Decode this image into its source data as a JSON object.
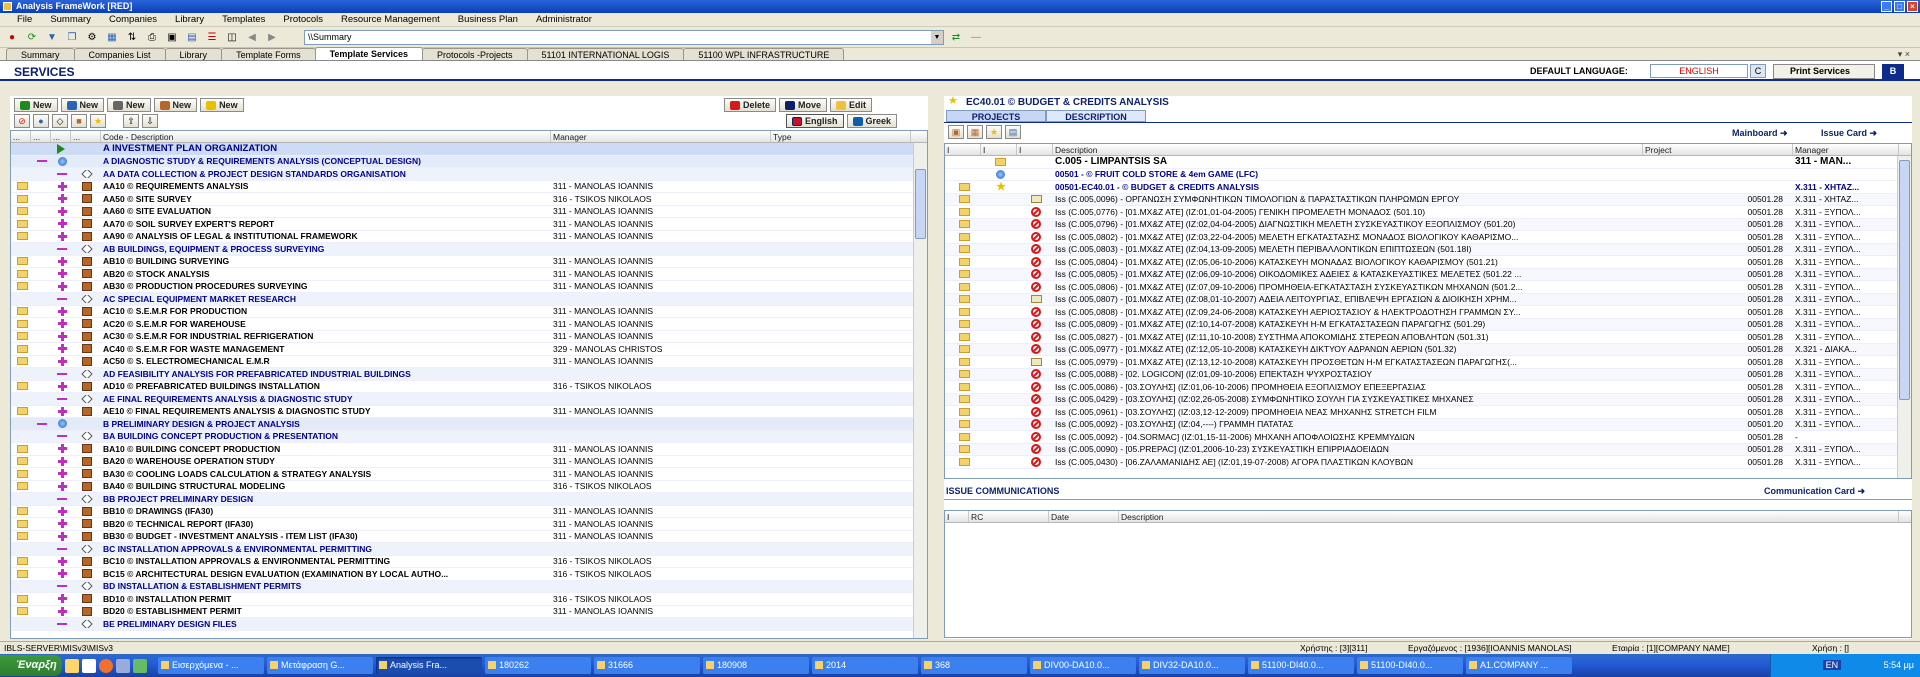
{
  "window": {
    "title": "Analysis FrameWork   [RED]"
  },
  "menu": [
    "File",
    "Summary",
    "Companies",
    "Library",
    "Templates",
    "Protocols",
    "Resource Management",
    "Business Plan",
    "Administrator"
  ],
  "toolbar": {
    "address": "\\\\Summary"
  },
  "tabs": [
    {
      "label": "Summary"
    },
    {
      "label": "Companies List"
    },
    {
      "label": "Library"
    },
    {
      "label": "Template Forms"
    },
    {
      "label": "Template Services",
      "active": true
    },
    {
      "label": "Protocols -Projects"
    },
    {
      "label": "51101 INTERNATIONAL LOGIS"
    },
    {
      "label": "51100 WPL INFRASTRUCTURE"
    }
  ],
  "header": {
    "title": "SERVICES",
    "default_language_label": "DEFAULT LANGUAGE:",
    "default_language_value": "ENGLISH",
    "c_button": "C",
    "print_button": "Print Services",
    "b_button": "B"
  },
  "left": {
    "new_buttons": [
      "New",
      "New",
      "New",
      "New",
      "New"
    ],
    "delete_label": "Delete",
    "move_label": "Move",
    "edit_label": "Edit",
    "english_label": "English",
    "greek_label": "Greek",
    "columns": [
      "...",
      "...",
      "...",
      "...",
      "Code - Description",
      "Manager",
      "Type"
    ],
    "rows": [
      {
        "k": "h1",
        "icons": [
          "",
          "",
          "tri",
          ""
        ],
        "text": "A INVESTMENT PLAN ORGANIZATION",
        "mgr": ""
      },
      {
        "k": "h2",
        "icons": [
          "",
          "dash",
          "globe",
          ""
        ],
        "text": "A DIAGNOSTIC STUDY & REQUIREMENTS ANALYSIS (CONCEPTUAL DESIGN)",
        "mgr": ""
      },
      {
        "k": "h3",
        "icons": [
          "",
          "",
          "dash",
          "diam"
        ],
        "text": "AA DATA COLLECTION & PROJECT DESIGN STANDARDS ORGANISATION",
        "mgr": ""
      },
      {
        "k": "it",
        "icons": [
          "fold",
          "",
          "plus",
          "book"
        ],
        "text": "AA10 © REQUIREMENTS ANALYSIS",
        "mgr": "311 - MANOLAS IOANNIS"
      },
      {
        "k": "it",
        "icons": [
          "fold",
          "",
          "plus",
          "book"
        ],
        "text": "AA50 © SITE SURVEY",
        "mgr": "316 - TSIKOS NIKOLAOS"
      },
      {
        "k": "it",
        "icons": [
          "fold",
          "",
          "plus",
          "book"
        ],
        "text": "AA60 © SITE EVALUATION",
        "mgr": "311 - MANOLAS IOANNIS"
      },
      {
        "k": "it",
        "icons": [
          "fold",
          "",
          "plus",
          "book"
        ],
        "text": "AA70 © SOIL SURVEY EXPERT'S REPORT",
        "mgr": "311 - MANOLAS IOANNIS"
      },
      {
        "k": "it",
        "icons": [
          "fold",
          "",
          "plus",
          "book"
        ],
        "text": "AA90 © ANALYSIS OF LEGAL & INSTITUTIONAL FRAMEWORK",
        "mgr": "311 - MANOLAS IOANNIS"
      },
      {
        "k": "h3",
        "icons": [
          "",
          "",
          "dash",
          "diam"
        ],
        "text": "AB BUILDINGS, EQUIPMENT & PROCESS SURVEYING",
        "mgr": ""
      },
      {
        "k": "it",
        "icons": [
          "fold",
          "",
          "plus",
          "book"
        ],
        "text": "AB10 © BUILDING SURVEYING",
        "mgr": "311 - MANOLAS IOANNIS"
      },
      {
        "k": "it",
        "icons": [
          "fold",
          "",
          "plus",
          "book"
        ],
        "text": "AB20 © STOCK ANALYSIS",
        "mgr": "311 - MANOLAS IOANNIS"
      },
      {
        "k": "it",
        "icons": [
          "fold",
          "",
          "plus",
          "book"
        ],
        "text": "AB30 © PRODUCTION PROCEDURES SURVEYING",
        "mgr": "311 - MANOLAS IOANNIS"
      },
      {
        "k": "h3",
        "icons": [
          "",
          "",
          "dash",
          "diam"
        ],
        "text": "AC SPECIAL EQUIPMENT MARKET RESEARCH",
        "mgr": ""
      },
      {
        "k": "it",
        "icons": [
          "fold",
          "",
          "plus",
          "book"
        ],
        "text": "AC10 © S.E.M.R FOR PRODUCTION",
        "mgr": "311 - MANOLAS IOANNIS"
      },
      {
        "k": "it",
        "icons": [
          "fold",
          "",
          "plus",
          "book"
        ],
        "text": "AC20 © S.E.M.R FOR WAREHOUSE",
        "mgr": "311 - MANOLAS IOANNIS"
      },
      {
        "k": "it",
        "icons": [
          "fold",
          "",
          "plus",
          "book"
        ],
        "text": "AC30 © S.E.M.R FOR INDUSTRIAL REFRIGERATION",
        "mgr": "311 - MANOLAS IOANNIS"
      },
      {
        "k": "it",
        "icons": [
          "fold",
          "",
          "plus",
          "book"
        ],
        "text": "AC40 © S.E.M.R FOR WASTE MANAGEMENT",
        "mgr": "329 - MANOLAS CHRISTOS"
      },
      {
        "k": "it",
        "icons": [
          "fold",
          "",
          "plus",
          "book"
        ],
        "text": "AC50 © S. ELECTROMECHANICAL E.M.R",
        "mgr": "311 - MANOLAS IOANNIS"
      },
      {
        "k": "h3",
        "icons": [
          "",
          "",
          "dash",
          "diam"
        ],
        "text": "AD FEASIBILITY ANALYSIS FOR PREFABRICATED INDUSTRIAL BUILDINGS",
        "mgr": ""
      },
      {
        "k": "it",
        "icons": [
          "fold",
          "",
          "plus",
          "book"
        ],
        "text": "AD10 ©  PREFABRICATED BUILDINGS INSTALLATION",
        "mgr": "316 - TSIKOS NIKOLAOS"
      },
      {
        "k": "h3",
        "icons": [
          "",
          "",
          "dash",
          "diam"
        ],
        "text": "AE FINAL REQUIREMENTS  ANALYSIS & DIAGNOSTIC STUDY",
        "mgr": ""
      },
      {
        "k": "it",
        "icons": [
          "fold",
          "",
          "plus",
          "book"
        ],
        "text": "AE10 © FINAL REQUIREMENTS  ANALYSIS & DIAGNOSTIC STUDY",
        "mgr": "311 - MANOLAS IOANNIS"
      },
      {
        "k": "h2",
        "icons": [
          "",
          "dash",
          "globe",
          ""
        ],
        "text": "B PRELIMINARY DESIGN & PROJECT ANALYSIS",
        "mgr": ""
      },
      {
        "k": "h3",
        "icons": [
          "",
          "",
          "dash",
          "diam"
        ],
        "text": "BA BUILDING CONCEPT PRODUCTION & PRESENTATION",
        "mgr": ""
      },
      {
        "k": "it",
        "icons": [
          "fold",
          "",
          "plus",
          "book"
        ],
        "text": "BA10 © BUILDING CONCEPT PRODUCTION",
        "mgr": "311 - MANOLAS IOANNIS"
      },
      {
        "k": "it",
        "icons": [
          "fold",
          "",
          "plus",
          "book"
        ],
        "text": "BA20 © WAREHOUSE OPERATION STUDY",
        "mgr": "311 - MANOLAS IOANNIS"
      },
      {
        "k": "it",
        "icons": [
          "fold",
          "",
          "plus",
          "book"
        ],
        "text": "BA30 © COOLING LOADS CALCULATION & STRATEGY ANALYSIS",
        "mgr": "311 - MANOLAS IOANNIS"
      },
      {
        "k": "it",
        "icons": [
          "fold",
          "",
          "plus",
          "book"
        ],
        "text": "BA40 © BUILDING STRUCTURAL MODELING",
        "mgr": "316 - TSIKOS NIKOLAOS"
      },
      {
        "k": "h3",
        "icons": [
          "",
          "",
          "dash",
          "diam"
        ],
        "text": "BB PROJECT PRELIMINARY DESIGN",
        "mgr": ""
      },
      {
        "k": "it",
        "icons": [
          "fold",
          "",
          "plus",
          "book"
        ],
        "text": "BB10 © DRAWINGS (IFA30)",
        "mgr": "311 - MANOLAS IOANNIS"
      },
      {
        "k": "it",
        "icons": [
          "fold",
          "",
          "plus",
          "book"
        ],
        "text": "BB20 © TECHNICAL REPORT (IFA30)",
        "mgr": "311 - MANOLAS IOANNIS"
      },
      {
        "k": "it",
        "icons": [
          "fold",
          "",
          "plus",
          "book"
        ],
        "text": "BB30 © BUDGET - INVESTMENT ANALYSIS - ITEM LIST (IFA30)",
        "mgr": "311 - MANOLAS IOANNIS"
      },
      {
        "k": "h3",
        "icons": [
          "",
          "",
          "dash",
          "diam"
        ],
        "text": "BC INSTALLATION APPROVALS & ENVIRONMENTAL PERMITTING",
        "mgr": ""
      },
      {
        "k": "it",
        "icons": [
          "fold",
          "",
          "plus",
          "book"
        ],
        "text": "BC10 © INSTALLATION APPROVALS & ENVIRONMENTAL PERMITTING",
        "mgr": "316 - TSIKOS NIKOLAOS"
      },
      {
        "k": "it",
        "icons": [
          "fold",
          "",
          "plus",
          "book"
        ],
        "text": "BC15  © ARCHITECTURAL DESIGN EVALUATION (EXAMINATION BY LOCAL AUTHO...",
        "mgr": "316 - TSIKOS NIKOLAOS"
      },
      {
        "k": "h3",
        "icons": [
          "",
          "",
          "dash",
          "diam"
        ],
        "text": "BD INSTALLATION & ESTABLISHMENT PERMITS",
        "mgr": ""
      },
      {
        "k": "it",
        "icons": [
          "fold",
          "",
          "plus",
          "book"
        ],
        "text": "BD10 © INSTALLATION PERMIT",
        "mgr": "316 - TSIKOS NIKOLAOS"
      },
      {
        "k": "it",
        "icons": [
          "fold",
          "",
          "plus",
          "book"
        ],
        "text": "BD20 © ESTABLISHMENT PERMIT",
        "mgr": "311 - MANOLAS IOANNIS"
      },
      {
        "k": "h3",
        "icons": [
          "",
          "",
          "dash",
          "diam"
        ],
        "text": "BE PRELIMINARY DESIGN FILES",
        "mgr": ""
      }
    ]
  },
  "right": {
    "title": "EC40.01  ©  BUDGET & CREDITS ANALYSIS",
    "tabs": [
      "PROJECTS",
      "DESCRIPTION"
    ],
    "mainboard_link": "Mainboard",
    "issue_card_link": "Issue Card",
    "columns": [
      "I",
      "I",
      "I",
      "Description",
      "Project",
      "Manager"
    ],
    "rows": [
      {
        "k": "top",
        "i": [
          "",
          "fold",
          ""
        ],
        "d": "C.005 - LIMPANTSIS SA",
        "p": "",
        "m": "311 - MAN..."
      },
      {
        "k": "sub",
        "i": [
          "",
          "globe",
          ""
        ],
        "d": "00501 - © FRUIT COLD STORE & 4em GAME (LFC)",
        "p": "",
        "m": ""
      },
      {
        "k": "sub2",
        "i": [
          "fold",
          "star",
          ""
        ],
        "d": "00501-EC40.01 - © BUDGET & CREDITS ANALYSIS",
        "p": "",
        "m": "X.311 - XHTAZ..."
      },
      {
        "k": "r",
        "i": [
          "fold",
          "",
          "env"
        ],
        "d": "Iss (C.005,0096) - ΟΡΓΑΝΩΣΗ ΣΥΜΦΩΝΗΤΙΚΩΝ ΤΙΜΟΛΟΓΙΩΝ & ΠΑΡΑΣΤΑΣΤΙΚΩΝ ΠΛΗΡΩΜΩΝ ΕΡΓΟΥ",
        "p": "00501.28",
        "m": "X.311 - XHTAZ..."
      },
      {
        "k": "r",
        "i": [
          "fold",
          "",
          "noent"
        ],
        "d": "Iss (C.005,0776) - [01.MX&Z ATE] (IZ:01,01-04-2005) ΓΕΝΙΚΗ ΠΡΟΜΕΛΕΤΗ ΜΟΝΑΔΟΣ (501.10)",
        "p": "00501.28",
        "m": "X.311 - ΞΥΠΟΛ..."
      },
      {
        "k": "r",
        "i": [
          "fold",
          "",
          "noent"
        ],
        "d": "Iss (C.005,0796) - [01.MX&Z ATE] (IZ:02,04-04-2005) ΔΙΑΓΝΩΣΤΙΚΗ ΜΕΛΕΤΗ ΣΥΣΚΕΥΑΣΤΙΚΟΥ ΕΞΟΠΛΙΣΜΟΥ (501.20)",
        "p": "00501.28",
        "m": "X.311 - ΞΥΠΟΛ..."
      },
      {
        "k": "r",
        "i": [
          "fold",
          "",
          "noent"
        ],
        "d": "Iss (C.005,0802) - [01.MX&Z ATE] (IZ:03,22-04-2005) ΜΕΛΕΤΗ ΕΓΚΑΤΑΣΤΑΣΗΣ ΜΟΝΑΔΟΣ ΒΙΟΛΟΓΙΚΟΥ ΚΑΘΑΡΙΣΜΟ...",
        "p": "00501.28",
        "m": "X.311 - ΞΥΠΟΛ..."
      },
      {
        "k": "r",
        "i": [
          "fold",
          "",
          "noent"
        ],
        "d": "Iss (C.005,0803) - [01.MX&Z ATE] (IZ:04,13-09-2005) ΜΕΛΕΤΗ ΠΕΡΙΒΑΛΛΟΝΤΙΚΩΝ ΕΠΙΠΤΩΣΕΩΝ (501.18I)",
        "p": "00501.28",
        "m": "X.311 - ΞΥΠΟΛ..."
      },
      {
        "k": "r",
        "i": [
          "fold",
          "",
          "noent"
        ],
        "d": "Iss (C.005,0804) - [01.MX&Z ATE] (IZ:05,06-10-2006) ΚΑΤΑΣΚΕΥΗ ΜΟΝΑΔΑΣ ΒΙΟΛΟΓΙΚΟΥ ΚΑΘΑΡΙΣΜΟΥ (501.21)",
        "p": "00501.28",
        "m": "X.311 - ΞΥΠΟΛ..."
      },
      {
        "k": "r",
        "i": [
          "fold",
          "",
          "noent"
        ],
        "d": "Iss (C.005,0805) - [01.MX&Z ATE] (IZ:06,09-10-2006) ΟΙΚΟΔΟΜΙΚΕΣ ΑΔΕΙΕΣ & ΚΑΤΑΣΚΕΥΑΣΤΙΚΕΣ ΜΕΛΕΤΕΣ (501.22 ...",
        "p": "00501.28",
        "m": "X.311 - ΞΥΠΟΛ..."
      },
      {
        "k": "r",
        "i": [
          "fold",
          "",
          "noent"
        ],
        "d": "Iss (C.005,0806) - [01.MX&Z ATE] (IZ:07,09-10-2006) ΠΡΟΜΗΘΕΙΑ-ΕΓΚΑΤΑΣΤΑΣΗ ΣΥΣΚΕΥΑΣΤΙΚΩΝ ΜΗΧΑΝΩΝ (501.2...",
        "p": "00501.28",
        "m": "X.311 - ΞΥΠΟΛ..."
      },
      {
        "k": "r",
        "i": [
          "fold",
          "",
          "env"
        ],
        "d": "Iss (C.005,0807) - [01.MX&Z ATE] (IZ:08,01-10-2007) ΑΔΕΙΑ ΛΕΙΤΟΥΡΓΙΑΣ, ΕΠΙΒΛΕΨΗ ΕΡΓΑΣΙΩΝ & ΔΙΟΙΚΗΣΗ ΧΡΗΜ...",
        "p": "00501.28",
        "m": "X.311 - ΞΥΠΟΛ..."
      },
      {
        "k": "r",
        "i": [
          "fold",
          "",
          "noent"
        ],
        "d": "Iss (C.005,0808) - [01.MX&Z ATE] (IZ:09,24-06-2008) ΚΑΤΑΣΚΕΥΗ ΑΕΡΙΟΣΤΑΣΙΟΥ & ΗΛΕΚΤΡΟΔΟΤΗΣΗ ΓΡΑΜΜΩΝ ΣΥ...",
        "p": "00501.28",
        "m": "X.311 - ΞΥΠΟΛ..."
      },
      {
        "k": "r",
        "i": [
          "fold",
          "",
          "noent"
        ],
        "d": "Iss (C.005,0809) - [01.MX&Z ATE] (IZ:10,14-07-2008) ΚΑΤΑΣΚΕΥΗ Η-Μ ΕΓΚΑΤΑΣΤΑΣΕΩΝ ΠΑΡΑΓΩΓΗΣ (501.29)",
        "p": "00501.28",
        "m": "X.311 - ΞΥΠΟΛ..."
      },
      {
        "k": "r",
        "i": [
          "fold",
          "",
          "noent"
        ],
        "d": "Iss (C.005,0827) - [01.MX&Z ATE] (IZ:11,10-10-2008) ΣΥΣΤΗΜΑ ΑΠΟΚΟΜΙΔΗΣ ΣΤΕΡΕΩΝ ΑΠΟΒΛΗΤΩΝ (501.31)",
        "p": "00501.28",
        "m": "X.311 - ΞΥΠΟΛ..."
      },
      {
        "k": "r",
        "i": [
          "fold",
          "",
          "noent"
        ],
        "d": "Iss (C.005,0977) - [01.MX&Z ATE] (IZ:12,05-10-2008) ΚΑΤΑΣΚΕΥΗ ΔΙΚΤΥΟΥ ΑΔΡΑΝΩΝ ΑΕΡΙΩΝ (501.32)",
        "p": "00501.28",
        "m": "X.321 - ΔΙΑΚΑ..."
      },
      {
        "k": "r",
        "i": [
          "fold",
          "",
          "env"
        ],
        "d": "Iss (C.005,0979) - [01.MX&Z ATE] (IZ:13,12-10-2008) ΚΑΤΑΣΚΕΥΗ ΠΡΟΣΘΕΤΩΝ  Η-Μ ΕΓΚΑΤΑΣΤΑΣΕΩΝ ΠΑΡΑΓΩΓΗΣ(...",
        "p": "00501.28",
        "m": "X.311 - ΞΥΠΟΛ..."
      },
      {
        "k": "r",
        "i": [
          "fold",
          "",
          "noent"
        ],
        "d": "Iss (C.005,0088) - [02. LOGICON] (IZ:01,09-10-2006) ΕΠΕΚΤΑΣΗ ΨΥΧΡΟΣΤΑΣΙΟΥ",
        "p": "00501.28",
        "m": "X.311 - ΞΥΠΟΛ..."
      },
      {
        "k": "r",
        "i": [
          "fold",
          "",
          "noent"
        ],
        "d": "Iss (C.005,0086) - [03.ΣΟΥΛΗΣ] (IZ:01,06-10-2006) ΠΡΟΜΗΘΕΙΑ ΕΞΟΠΛΙΣΜΟΥ ΕΠΕΞΕΡΓΑΣΙΑΣ",
        "p": "00501.28",
        "m": "X.311 - ΞΥΠΟΛ..."
      },
      {
        "k": "r",
        "i": [
          "fold",
          "",
          "noent"
        ],
        "d": "Iss (C.005,0429) - [03.ΣΟΥΛΗΣ] (IZ:02,26-05-2008) ΣΥΜΦΩΝΗΤΙΚΟ ΣΟΥΛΗ ΓΙΑ ΣΥΣΚΕΥΑΣΤΙΚΕΣ ΜΗΧΑΝΕΣ",
        "p": "00501.28",
        "m": "X.311 - ΞΥΠΟΛ..."
      },
      {
        "k": "r",
        "i": [
          "fold",
          "",
          "noent"
        ],
        "d": "Iss (C.005,0961) - [03.ΣΟΥΛΗΣ] (IZ:03,12-12-2009) ΠΡΟΜΗΘΕΙΑ ΝΕΑΣ ΜΗΧΑΝΗΣ STRETCH FILM",
        "p": "00501.28",
        "m": "X.311 - ΞΥΠΟΛ..."
      },
      {
        "k": "r",
        "i": [
          "fold",
          "",
          "noent"
        ],
        "d": "Iss (C.005,0092) - [03.ΣΟΥΛΗΣ] (IZ:04,----) ΓΡΑΜΜΗ ΠΑΤΑΤΑΣ",
        "p": "00501.20",
        "m": "X.311 - ΞΥΠΟΛ..."
      },
      {
        "k": "r",
        "i": [
          "fold",
          "",
          "noent"
        ],
        "d": "Iss (C.005,0092) - [04.SORMAC] (IZ:01,15-11-2006)  ΜΗΧΑΝΗ ΑΠΟΦΛΟΙΩΣΗΣ ΚΡΕΜΜΥΔΙΩΝ",
        "p": "00501.28",
        "m": "-"
      },
      {
        "k": "r",
        "i": [
          "fold",
          "",
          "noent"
        ],
        "d": "Iss (C.005,0090) - [05.PREPAC] (IZ:01,2006-10-23) ΣΥΣΚΕΥΑΣΤΙΚΗ ΕΠΙΡΡΙΑΔΟΕΙΔΩΝ",
        "p": "00501.28",
        "m": "X.311 - ΞΥΠΟΛ..."
      },
      {
        "k": "r",
        "i": [
          "fold",
          "",
          "noent"
        ],
        "d": "Iss (C.005,0430) - [06.ΖΑΛΑΜΑΝΙΔΗΣ ΑΕ] (IZ:01,19-07-2008) ΑΓΟΡΑ ΠΛΑΣΤΙΚΩΝ ΚΛΟΥΒΩΝ",
        "p": "00501.28",
        "m": "X.311 - ΞΥΠΟΛ..."
      }
    ],
    "issue_comm_title": "ISSUE COMMUNICATIONS",
    "communication_card_link": "Communication Card",
    "comm_columns": [
      "I",
      "RC",
      "Date",
      "Description"
    ]
  },
  "status": {
    "left": "IBLS-SERVER\\MISv3\\MISv3",
    "user": "Χρήστης : [3][311]",
    "worker": "Εργαζόμενος : [1936][IOANNIS MANOLAS]",
    "company": "Εταιρία : [1][COMPANY NAME]",
    "year": "Χρήση : []"
  },
  "taskbar": {
    "start": "Έναρξη",
    "items": [
      "Εισερχόμενα - ...",
      "Μετάφραση G...",
      "Analysis Fra...",
      "180262",
      "31666",
      "180908",
      "2014",
      "368",
      "DIV00-DA10.0...",
      "DIV32-DA10.0...",
      "51100-DI40.0...",
      "51100-DI40.0...",
      "A1.COMPANY ..."
    ],
    "active_index": 2,
    "lang": "EN",
    "clock": "5:54 μμ"
  }
}
